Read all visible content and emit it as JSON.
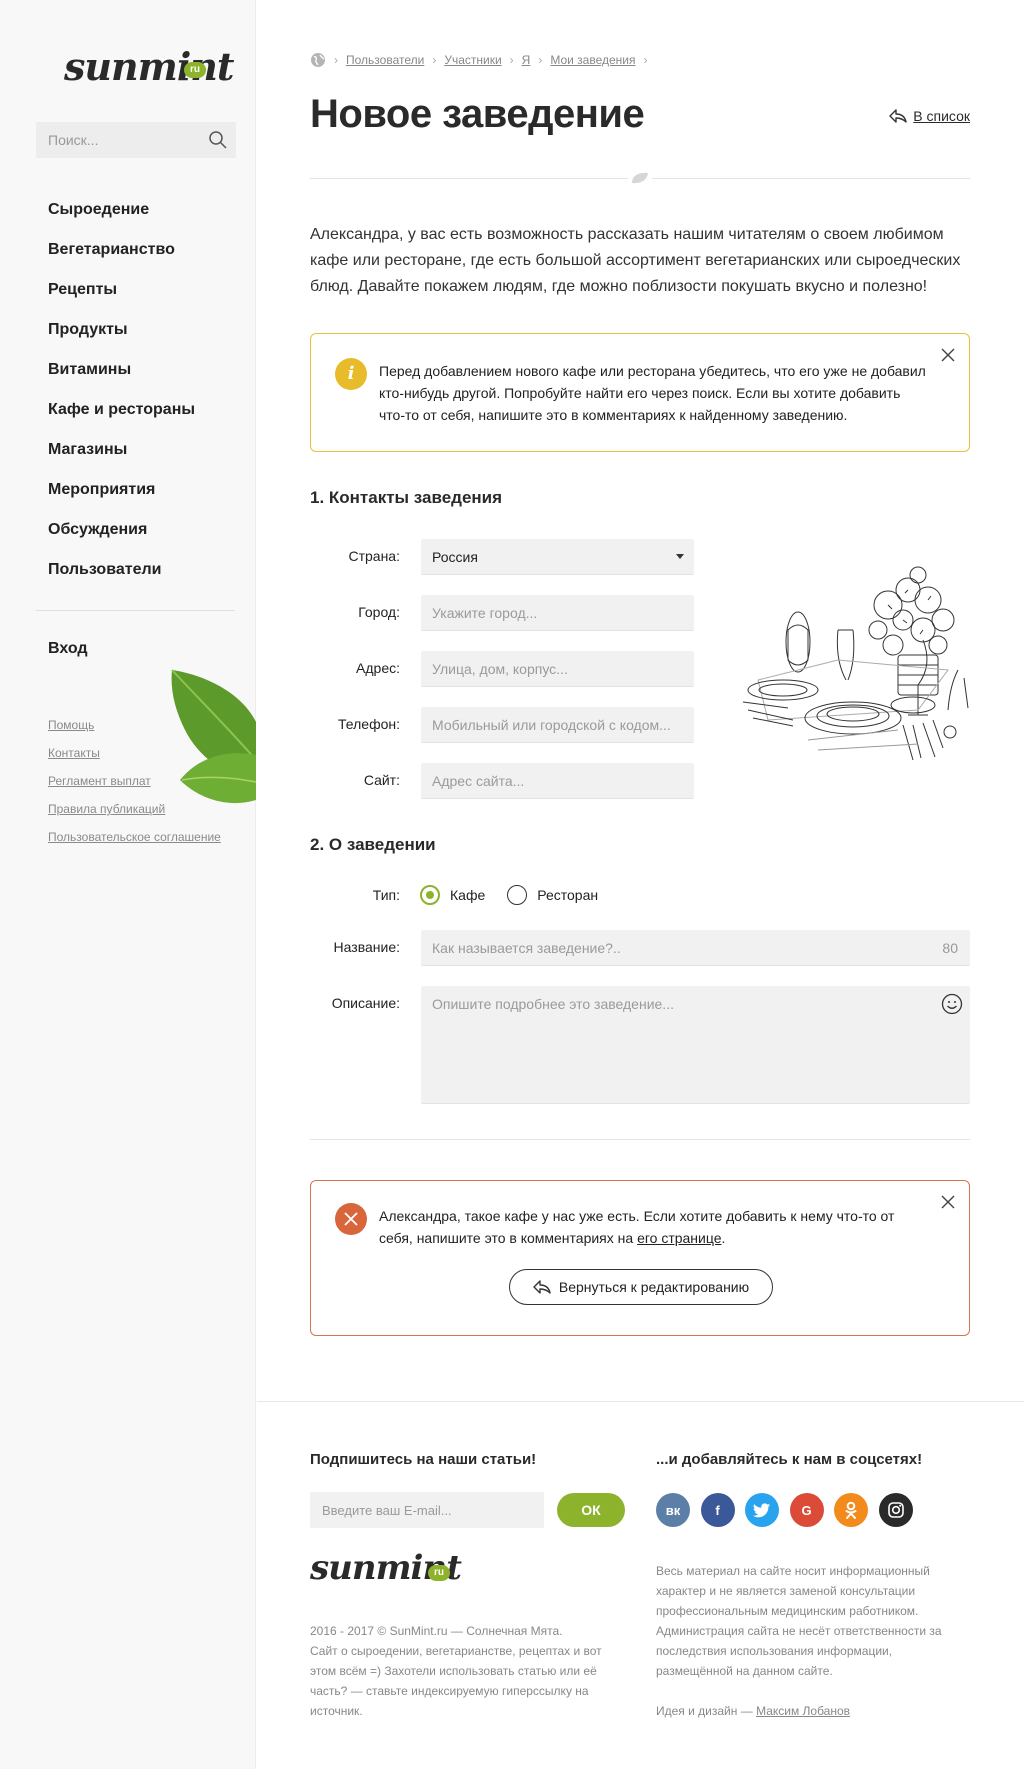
{
  "logo": {
    "text": "sunmint",
    "badge": "ru"
  },
  "sidebar": {
    "search_placeholder": "Поиск...",
    "nav": [
      "Сыроедение",
      "Вегетарианство",
      "Рецепты",
      "Продукты",
      "Витамины",
      "Кафе и рестораны",
      "Магазины",
      "Мероприятия",
      "Обсуждения",
      "Пользователи"
    ],
    "login": "Вход",
    "links": [
      "Помощь",
      "Контакты",
      "Регламент выплат",
      "Правила публикаций",
      "Пользовательское соглашение"
    ]
  },
  "breadcrumb": [
    "Пользователи",
    "Участники",
    "Я",
    "Мои заведения"
  ],
  "page": {
    "title": "Новое заведение",
    "back_link": "В список",
    "intro": "Александра, у вас есть возможность рассказать нашим читателям о своем любимом кафе или ресторане, где есть большой ассортимент вегетарианских или сыроедческих блюд. Давайте покажем людям, где можно поблизости покушать вкусно и полезно!"
  },
  "warning": {
    "icon": "i",
    "text": "Перед добавлением нового кафе или ресторана убедитесь, что его уже не добавил кто-нибудь другой. Попробуйте найти его через поиск. Если вы хотите добавить что-то от себя, напишите это в комментариях к найденному заведению."
  },
  "section1": {
    "title": "1. Контакты заведения",
    "country_label": "Страна:",
    "country_value": "Россия",
    "city_label": "Город:",
    "city_placeholder": "Укажите город...",
    "address_label": "Адрес:",
    "address_placeholder": "Улица, дом, корпус...",
    "phone_label": "Телефон:",
    "phone_placeholder": "Мобильный или городской с кодом...",
    "site_label": "Сайт:",
    "site_placeholder": "Адрес сайта..."
  },
  "section2": {
    "title": "2. О заведении",
    "type_label": "Тип:",
    "type_options": [
      "Кафе",
      "Ресторан"
    ],
    "type_selected": "Кафе",
    "name_label": "Название:",
    "name_placeholder": "Как называется заведение?..",
    "name_counter": "80",
    "desc_label": "Описание:",
    "desc_placeholder": "Опишите подробнее это заведение..."
  },
  "error": {
    "text_before": "Александра, такое кафе у нас уже есть. Если хотите добавить к нему что-то от себя, напишите это в комментариях на ",
    "link": "его странице",
    "text_after": ".",
    "button": "Вернуться к редактированию"
  },
  "footer": {
    "subscribe_title": "Подпишитесь на наши статьи!",
    "email_placeholder": "Введите ваш E-mail...",
    "ok_label": "ОК",
    "social_title": "...и добавляйтесь к нам в соцсетях!",
    "socials": [
      {
        "name": "vk",
        "label": "вк",
        "color": "#5b7fa6"
      },
      {
        "name": "facebook",
        "label": "f",
        "color": "#3b5998"
      },
      {
        "name": "twitter",
        "label": "t",
        "color": "#2aa3ef"
      },
      {
        "name": "google",
        "label": "G",
        "color": "#dc4a38"
      },
      {
        "name": "odnoklassniki",
        "label": "ok",
        "color": "#f28b1b"
      },
      {
        "name": "instagram",
        "label": "ig",
        "color": "#2a2a2a"
      }
    ],
    "copyright_line1": "2016 - 2017 © SunMint.ru — Солнечная Мята.",
    "copyright_line2": "Сайт о сыроедении, вегетарианстве, рецептах и вот",
    "copyright_line3": "этом всём =) Захотели использовать статью или её",
    "copyright_line4": "часть? — ставьте индексируемую гиперссылку на",
    "copyright_line5": "источник.",
    "disclaimer_lines": [
      "Весь материал на сайте носит информационный",
      "характер и не является заменой консультации",
      "профессиональным медицинским работником.",
      "Администрация сайта не несёт ответственности за",
      "последствия использования информации,",
      "размещённой на данном сайте."
    ],
    "credit_prefix": "Идея и дизайн — ",
    "credit_name": "Максим Лобанов"
  },
  "colors": {
    "accent": "#8db32c",
    "warning": "#e9c13a",
    "error": "#d9653b"
  }
}
